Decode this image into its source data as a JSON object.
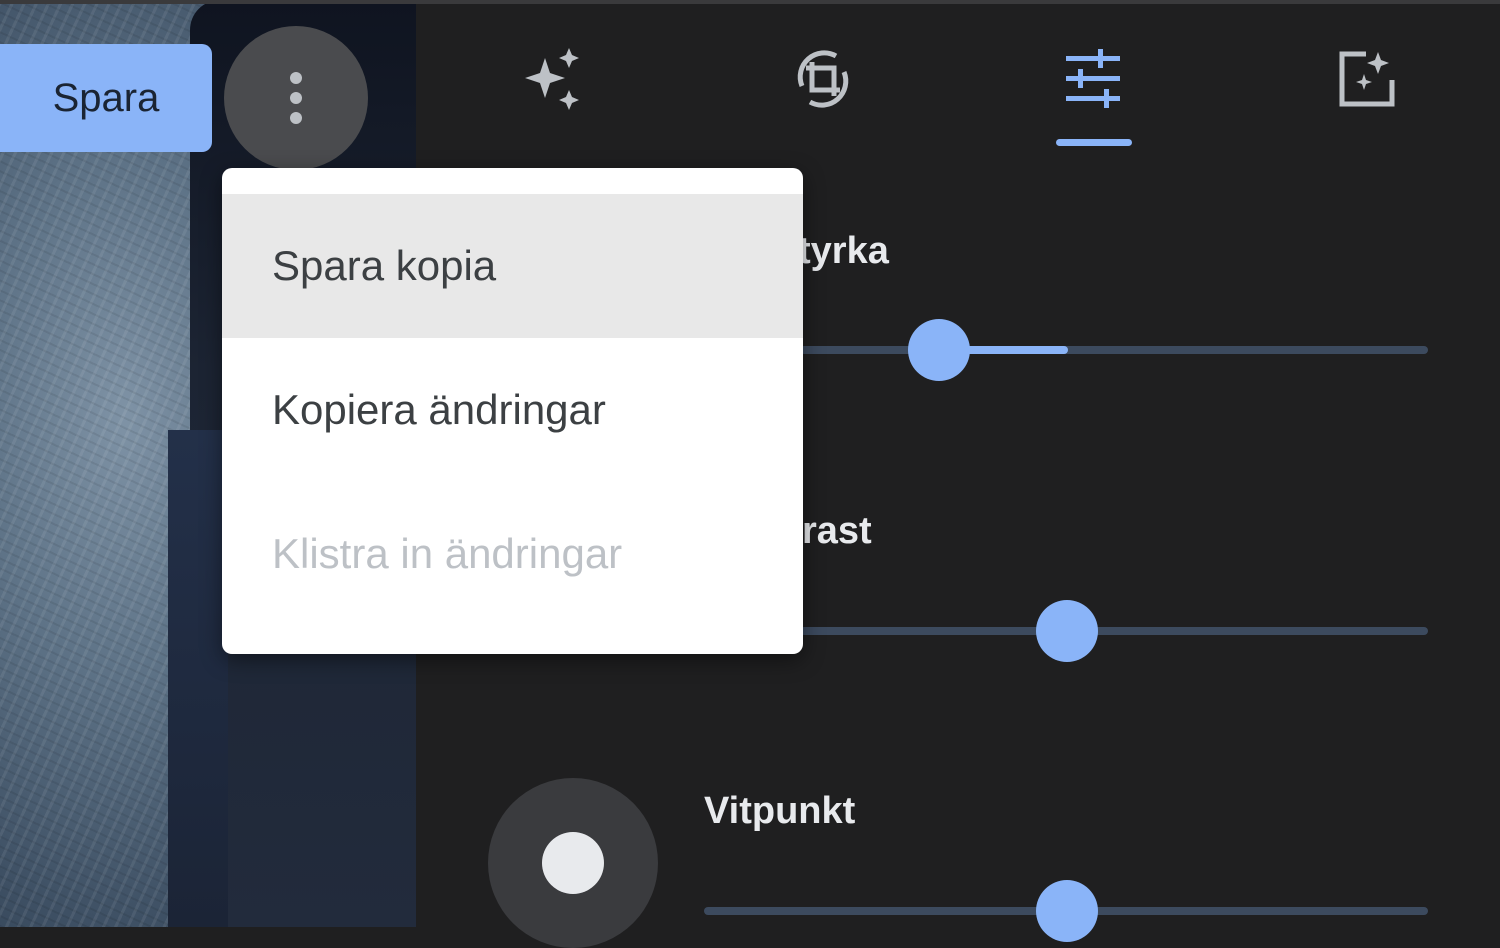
{
  "colors": {
    "accent": "#8ab4f8",
    "panel_bg": "#1f1f20",
    "menu_bg": "#ffffff",
    "menu_text": "#3c4043",
    "menu_disabled": "#bdc1c6"
  },
  "toolbar": {
    "save_label": "Spara",
    "more_icon": "more-vert-icon"
  },
  "tabs": [
    {
      "icon": "auto-enhance-sparkle-icon",
      "selected": false
    },
    {
      "icon": "crop-rotate-icon",
      "selected": false
    },
    {
      "icon": "tune-sliders-icon",
      "selected": true
    },
    {
      "icon": "filter-add-icon",
      "selected": false
    }
  ],
  "menu": {
    "items": [
      {
        "label": "Spara kopia",
        "state": "hover"
      },
      {
        "label": "Kopiera ändringar",
        "state": "normal"
      },
      {
        "label": "Klistra in ändringar",
        "state": "disabled"
      }
    ]
  },
  "adjustments": [
    {
      "label_visible": "tyrka",
      "value_fraction": 0.21,
      "fill_to_fraction": 0.38
    },
    {
      "label_visible": "rast",
      "value_fraction": 0.38
    },
    {
      "label_visible": "Vitpunkt",
      "value_fraction": 0.5
    }
  ]
}
